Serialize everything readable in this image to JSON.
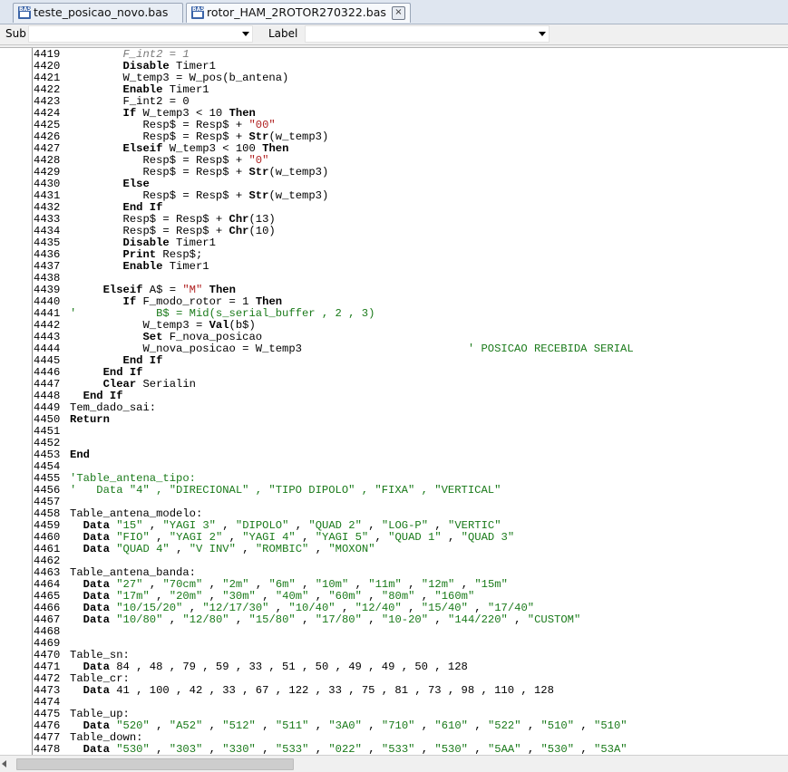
{
  "tabs": [
    {
      "label": "teste_posicao_novo.bas",
      "icon": "bas-file-icon"
    },
    {
      "label": "rotor_HAM_2ROTOR270322.bas",
      "icon": "bas-file-icon",
      "active": true
    }
  ],
  "toolbar": {
    "sub_label": "Sub",
    "sub_value": "",
    "label_label": "Label",
    "label_value": ""
  },
  "code_lines": [
    {
      "n": "4419",
      "t": "        F_int2 = 1",
      "c": "cmi"
    },
    {
      "n": "4420",
      "t": "        Disable Timer1"
    },
    {
      "n": "4421",
      "t": "        W_temp3 = W_pos(b_antena)"
    },
    {
      "n": "4422",
      "t": "        Enable Timer1"
    },
    {
      "n": "4423",
      "t": "        F_int2 = 0"
    },
    {
      "n": "4424",
      "t": "        If W_temp3 < 10 Then"
    },
    {
      "n": "4425",
      "t": "           Resp$ = Resp$ + \"00\""
    },
    {
      "n": "4426",
      "t": "           Resp$ = Resp$ + Str(w_temp3)"
    },
    {
      "n": "4427",
      "t": "        Elseif W_temp3 < 100 Then"
    },
    {
      "n": "4428",
      "t": "           Resp$ = Resp$ + \"0\""
    },
    {
      "n": "4429",
      "t": "           Resp$ = Resp$ + Str(w_temp3)"
    },
    {
      "n": "4430",
      "t": "        Else"
    },
    {
      "n": "4431",
      "t": "           Resp$ = Resp$ + Str(w_temp3)"
    },
    {
      "n": "4432",
      "t": "        End If"
    },
    {
      "n": "4433",
      "t": "        Resp$ = Resp$ + Chr(13)"
    },
    {
      "n": "4434",
      "t": "        Resp$ = Resp$ + Chr(10)"
    },
    {
      "n": "4435",
      "t": "        Disable Timer1"
    },
    {
      "n": "4436",
      "t": "        Print Resp$;"
    },
    {
      "n": "4437",
      "t": "        Enable Timer1"
    },
    {
      "n": "4438",
      "t": ""
    },
    {
      "n": "4439",
      "t": "     Elseif A$ = \"M\" Then"
    },
    {
      "n": "4440",
      "t": "        If F_modo_rotor = 1 Then"
    },
    {
      "n": "4441",
      "t": "'            B$ = Mid(s_serial_buffer , 2 , 3)",
      "c": "cm"
    },
    {
      "n": "4442",
      "t": "           W_temp3 = Val(b$)"
    },
    {
      "n": "4443",
      "t": "           Set F_nova_posicao"
    },
    {
      "n": "4444",
      "t": "           W_nova_posicao = W_temp3                         ' POSICAO RECEBIDA SERIAL"
    },
    {
      "n": "4445",
      "t": "        End If"
    },
    {
      "n": "4446",
      "t": "     End If"
    },
    {
      "n": "4447",
      "t": "     Clear Serialin"
    },
    {
      "n": "4448",
      "t": "  End If"
    },
    {
      "n": "4449",
      "t": "Tem_dado_sai:"
    },
    {
      "n": "4450",
      "t": "Return"
    },
    {
      "n": "4451",
      "t": ""
    },
    {
      "n": "4452",
      "t": ""
    },
    {
      "n": "4453",
      "t": "End"
    },
    {
      "n": "4454",
      "t": ""
    },
    {
      "n": "4455",
      "t": "'Table_antena_tipo:",
      "c": "cm"
    },
    {
      "n": "4456",
      "t": "'   Data \"4\" , \"DIRECIONAL\" , \"TIPO DIPOLO\" , \"FIXA\" , \"VERTICAL\"",
      "c": "cm"
    },
    {
      "n": "4457",
      "t": ""
    },
    {
      "n": "4458",
      "t": "Table_antena_modelo:"
    },
    {
      "n": "4459",
      "t": "  Data \"15\" , \"YAGI 3\" , \"DIPOLO\" , \"QUAD 2\" , \"LOG-P\" , \"VERTIC\""
    },
    {
      "n": "4460",
      "t": "  Data \"FIO\" , \"YAGI 2\" , \"YAGI 4\" , \"YAGI 5\" , \"QUAD 1\" , \"QUAD 3\""
    },
    {
      "n": "4461",
      "t": "  Data \"QUAD 4\" , \"V INV\" , \"ROMBIC\" , \"MOXON\""
    },
    {
      "n": "4462",
      "t": ""
    },
    {
      "n": "4463",
      "t": "Table_antena_banda:"
    },
    {
      "n": "4464",
      "t": "  Data \"27\" , \"70cm\" , \"2m\" , \"6m\" , \"10m\" , \"11m\" , \"12m\" , \"15m\""
    },
    {
      "n": "4465",
      "t": "  Data \"17m\" , \"20m\" , \"30m\" , \"40m\" , \"60m\" , \"80m\" , \"160m\""
    },
    {
      "n": "4466",
      "t": "  Data \"10/15/20\" , \"12/17/30\" , \"10/40\" , \"12/40\" , \"15/40\" , \"17/40\""
    },
    {
      "n": "4467",
      "t": "  Data \"10/80\" , \"12/80\" , \"15/80\" , \"17/80\" , \"10-20\" , \"144/220\" , \"CUSTOM\""
    },
    {
      "n": "4468",
      "t": ""
    },
    {
      "n": "4469",
      "t": ""
    },
    {
      "n": "4470",
      "t": "Table_sn:"
    },
    {
      "n": "4471",
      "t": "  Data 84 , 48 , 79 , 59 , 33 , 51 , 50 , 49 , 49 , 50 , 128"
    },
    {
      "n": "4472",
      "t": "Table_cr:"
    },
    {
      "n": "4473",
      "t": "  Data 41 , 100 , 42 , 33 , 67 , 122 , 33 , 75 , 81 , 73 , 98 , 110 , 128"
    },
    {
      "n": "4474",
      "t": ""
    },
    {
      "n": "4475",
      "t": "Table_up:"
    },
    {
      "n": "4476",
      "t": "  Data \"520\" , \"A52\" , \"512\" , \"511\" , \"3A0\" , \"710\" , \"610\" , \"522\" , \"510\" , \"510\""
    },
    {
      "n": "4477",
      "t": "Table_down:"
    },
    {
      "n": "4478",
      "t": "  Data \"530\" , \"303\" , \"330\" , \"533\" , \"022\" , \"533\" , \"530\" , \"5AA\" , \"530\" , \"53A\""
    }
  ],
  "colors": {
    "keyword": "#000000",
    "string": "#b02020",
    "string_in_data": "#1a7a1a",
    "comment": "#1a7a1a",
    "operator": "#c00000"
  }
}
